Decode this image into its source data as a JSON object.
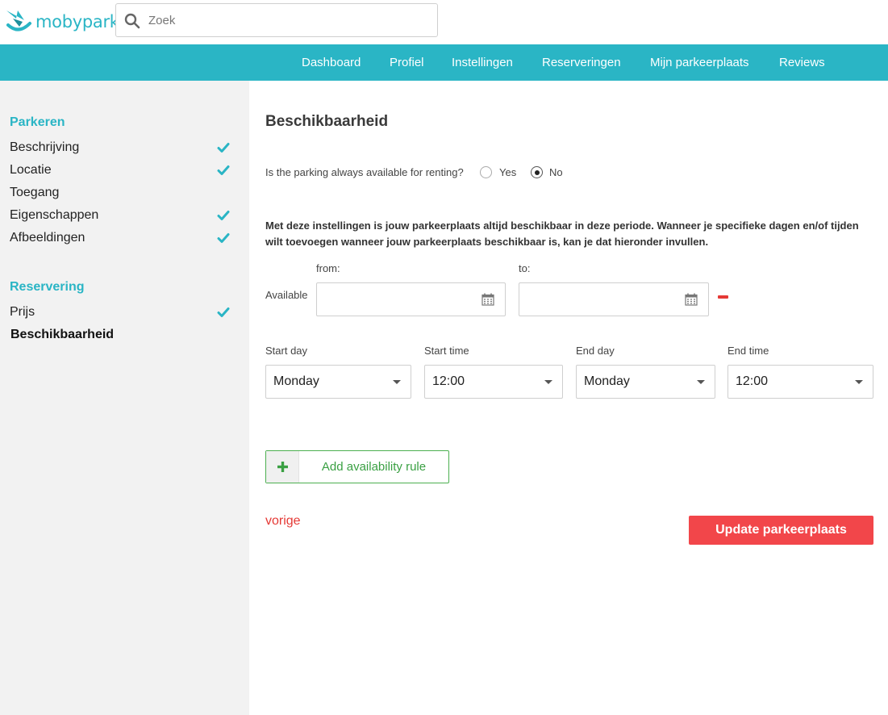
{
  "header": {
    "logo_text": "mobypark",
    "search": {
      "placeholder": "Zoek",
      "value": ""
    }
  },
  "nav": {
    "items": [
      "Dashboard",
      "Profiel",
      "Instellingen",
      "Reserveringen",
      "Mijn parkeerplaats",
      "Reviews"
    ]
  },
  "sidebar": {
    "sections": [
      {
        "heading": "Parkeren",
        "items": [
          {
            "label": "Beschrijving",
            "completed": true
          },
          {
            "label": "Locatie",
            "completed": true
          },
          {
            "label": "Toegang",
            "completed": false
          },
          {
            "label": "Eigenschappen",
            "completed": true
          },
          {
            "label": "Afbeeldingen",
            "completed": true
          }
        ]
      },
      {
        "heading": "Reservering",
        "items": [
          {
            "label": "Prijs",
            "completed": true
          },
          {
            "label": "Beschikbaarheid",
            "completed": false,
            "active": true
          }
        ]
      }
    ]
  },
  "main": {
    "title": "Beschikbaarheid",
    "question": "Is the parking always available for renting?",
    "options": {
      "yes": "Yes",
      "no": "No",
      "selected": "No"
    },
    "info": "Met deze instellingen is jouw parkeerplaats altijd beschikbaar in deze periode. Wanneer je specifieke dagen en/of tijden wilt toevoegen wanneer jouw parkeerplaats beschikbaar is, kan je dat hieronder invullen.",
    "availability": {
      "label": "Available",
      "from_label": "from:",
      "to_label": "to:",
      "from_value": "",
      "to_value": ""
    },
    "rule": {
      "start_day_label": "Start day",
      "start_day": "Monday",
      "start_time_label": "Start time",
      "start_time": "12:00",
      "end_day_label": "End day",
      "end_day": "Monday",
      "end_time_label": "End time",
      "end_time": "12:00"
    },
    "add_rule_label": "Add availability rule",
    "prev_label": "vorige",
    "update_label": "Update parkeerplaats"
  },
  "colors": {
    "brand": "#2ab5c5",
    "danger": "#f2464a",
    "success": "#3aa043"
  }
}
